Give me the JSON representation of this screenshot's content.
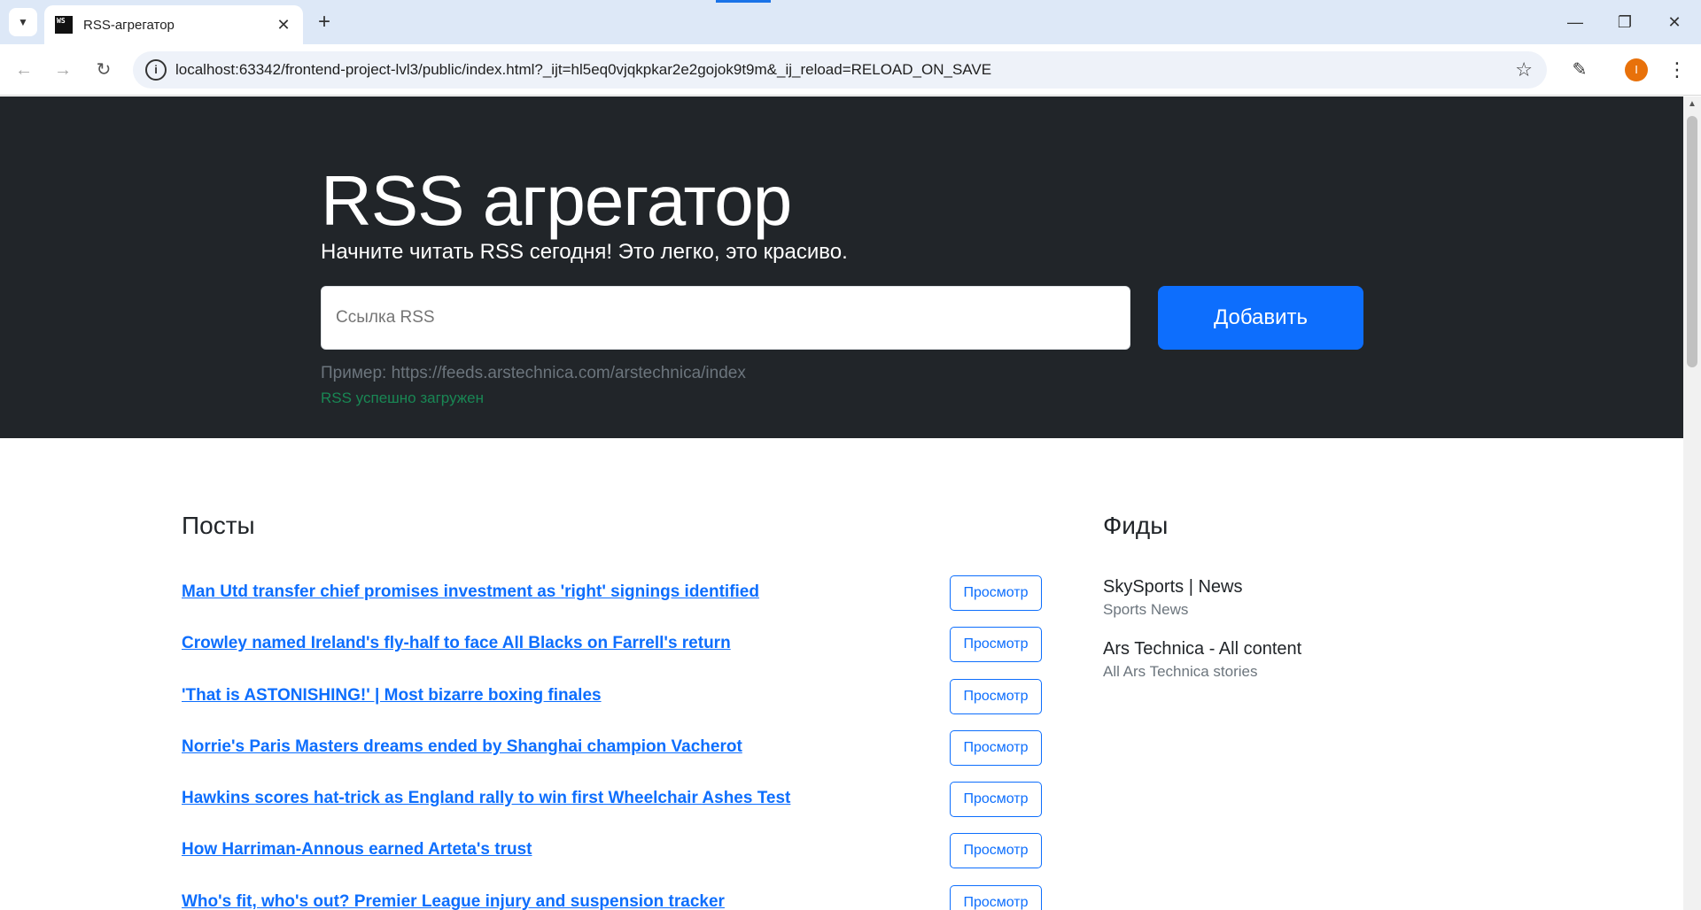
{
  "browser": {
    "tab_title": "RSS-агрегатор",
    "favicon_text": "WS",
    "url": "localhost:63342/frontend-project-lvl3/public/index.html?_ijt=hl5eq0vjqkpkar2e2gojok9t9m&_ij_reload=RELOAD_ON_SAVE",
    "profile_initial": "I"
  },
  "hero": {
    "title": "RSS агрегатор",
    "lead": "Начните читать RSS сегодня! Это легко, это красиво.",
    "input_placeholder": "Ссылка RSS",
    "add_button": "Добавить",
    "example": "Пример: https://feeds.arstechnica.com/arstechnica/index",
    "feedback": "RSS успешно загружен"
  },
  "posts": {
    "heading": "Посты",
    "view_label": "Просмотр",
    "items": [
      "Man Utd transfer chief promises investment as 'right' signings identified",
      "Crowley named Ireland's fly-half to face All Blacks on Farrell's return",
      "'That is ASTONISHING!' | Most bizarre boxing finales",
      "Norrie's Paris Masters dreams ended by Shanghai champion Vacherot",
      "Hawkins scores hat-trick as England rally to win first Wheelchair Ashes Test",
      "How Harriman-Annous earned Arteta's trust",
      "Who's fit, who's out? Premier League injury and suspension tracker"
    ]
  },
  "feeds": {
    "heading": "Фиды",
    "items": [
      {
        "title": "SkySports | News",
        "description": "Sports News"
      },
      {
        "title": "Ars Technica - All content",
        "description": "All Ars Technica stories"
      }
    ]
  },
  "colors": {
    "hero_bg": "#212529",
    "primary": "#0d6efd",
    "success": "#198754",
    "muted": "#6c757d"
  }
}
